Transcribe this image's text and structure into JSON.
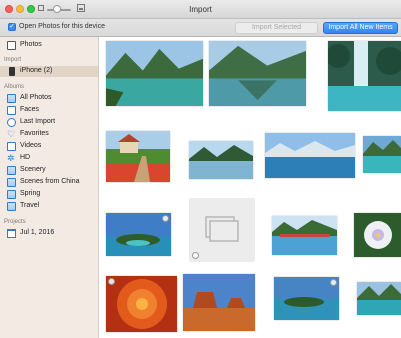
{
  "window": {
    "title": "Import"
  },
  "toolbar": {
    "open_photos_label": "Open Photos for this device",
    "open_photos_checked": true,
    "import_selected_label": "Import Selected",
    "import_all_label": "Import All New Items",
    "accent_color": "#2f86f5"
  },
  "zoom": {
    "level": 0.4
  },
  "sidebar": {
    "top_item": {
      "label": "Photos",
      "icon": "photos-monitor-icon"
    },
    "import_header": "Import",
    "device": {
      "label": "iPhone (2)",
      "icon": "iphone-icon"
    },
    "albums_header": "Albums",
    "albums": [
      {
        "label": "All Photos",
        "icon": "album-icon"
      },
      {
        "label": "Faces",
        "icon": "faces-icon"
      },
      {
        "label": "Last Import",
        "icon": "clock-icon"
      },
      {
        "label": "Favorites",
        "icon": "heart-icon"
      },
      {
        "label": "Videos",
        "icon": "video-icon"
      },
      {
        "label": "HD",
        "icon": "gear-icon"
      },
      {
        "label": "Scenery",
        "icon": "album-icon"
      },
      {
        "label": "Scenes from China",
        "icon": "album-icon"
      },
      {
        "label": "Spring",
        "icon": "album-icon"
      },
      {
        "label": "Travel",
        "icon": "album-icon"
      }
    ],
    "projects_header": "Projects",
    "projects": [
      {
        "label": "Jul 1, 2016",
        "icon": "calendar-icon"
      }
    ]
  },
  "photos": [
    {
      "name": "photo-mountain-lake",
      "kind": "lake"
    },
    {
      "name": "photo-green-lake",
      "kind": "lake2"
    },
    {
      "name": "photo-waterfall",
      "kind": "waterfall"
    },
    {
      "name": "photo-flower-garden",
      "kind": "garden"
    },
    {
      "name": "photo-lake-reflection",
      "kind": "lake3"
    },
    {
      "name": "photo-blue-lake",
      "kind": "lake4"
    },
    {
      "name": "photo-turquoise-lake",
      "kind": "lake5"
    },
    {
      "name": "photo-island",
      "kind": "island"
    },
    {
      "name": "photo-placeholder",
      "kind": "placeholder"
    },
    {
      "name": "photo-lake-village",
      "kind": "village"
    },
    {
      "name": "photo-white-flower",
      "kind": "flower"
    },
    {
      "name": "photo-red-flower",
      "kind": "redflower"
    },
    {
      "name": "photo-canyon",
      "kind": "canyon"
    },
    {
      "name": "photo-island-2",
      "kind": "island2"
    },
    {
      "name": "photo-mountain-lake-2",
      "kind": "lake6"
    }
  ]
}
